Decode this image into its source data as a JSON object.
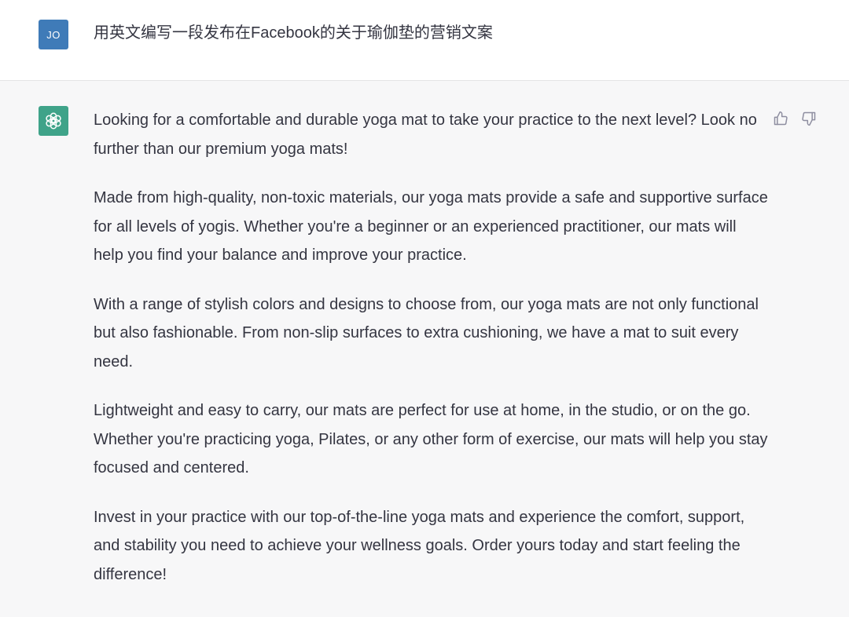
{
  "user_message": {
    "avatar_initials": "JO",
    "text": "用英文编写一段发布在Facebook的关于瑜伽垫的营销文案"
  },
  "assistant_message": {
    "avatar_icon": "openai-logo-icon",
    "paragraphs": [
      "Looking for a comfortable and durable yoga mat to take your practice to the next level? Look no further than our premium yoga mats!",
      "Made from high-quality, non-toxic materials, our yoga mats provide a safe and supportive surface for all levels of yogis. Whether you're a beginner or an experienced practitioner, our mats will help you find your balance and improve your practice.",
      "With a range of stylish colors and designs to choose from, our yoga mats are not only functional but also fashionable. From non-slip surfaces to extra cushioning, we have a mat to suit every need.",
      "Lightweight and easy to carry, our mats are perfect for use at home, in the studio, or on the go. Whether you're practicing yoga, Pilates, or any other form of exercise, our mats will help you stay focused and centered.",
      "Invest in your practice with our top-of-the-line yoga mats and experience the comfort, support, and stability you need to achieve your wellness goals. Order yours today and start feeling the difference!"
    ],
    "feedback": {
      "thumbs_up_icon": "thumbs-up-icon",
      "thumbs_down_icon": "thumbs-down-icon"
    }
  },
  "colors": {
    "user_avatar_bg": "#3f7bb8",
    "assistant_avatar_bg": "#3fa389",
    "assistant_row_bg": "#f7f7f8",
    "text": "#343541"
  }
}
